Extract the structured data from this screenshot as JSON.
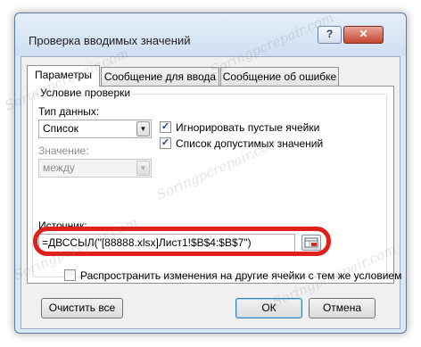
{
  "dialog": {
    "title": "Проверка вводимых значений",
    "help_label": "?",
    "close_label": "✕"
  },
  "tabs": [
    {
      "label": "Параметры",
      "active": true
    },
    {
      "label": "Сообщение для ввода",
      "active": false
    },
    {
      "label": "Сообщение об ошибке",
      "active": false
    }
  ],
  "validation": {
    "group_label": "Условие проверки",
    "type_label": "Тип данных:",
    "type_value": "Список",
    "value_label": "Значение:",
    "value_value": "между",
    "ignore_blank_label": "Игнорировать пустые ячейки",
    "ignore_blank_checked": true,
    "in_cell_dropdown_label": "Список допустимых значений",
    "in_cell_dropdown_checked": true,
    "source_label": "Источник:",
    "source_value": "=ДВССЫЛ(\"[88888.xlsx]Лист1!$B$4:$B$7\")"
  },
  "spread": {
    "label": "Распространить изменения на другие ячейки с тем же условием",
    "checked": false
  },
  "buttons": {
    "clear_all": "Очистить все",
    "ok": "ОК",
    "cancel": "Отмена"
  },
  "watermark": "Soringpcrepair.com",
  "colors": {
    "highlight": "#e0201b",
    "dialog_frame": "#d9e6f4",
    "close_button": "#c5452e"
  }
}
